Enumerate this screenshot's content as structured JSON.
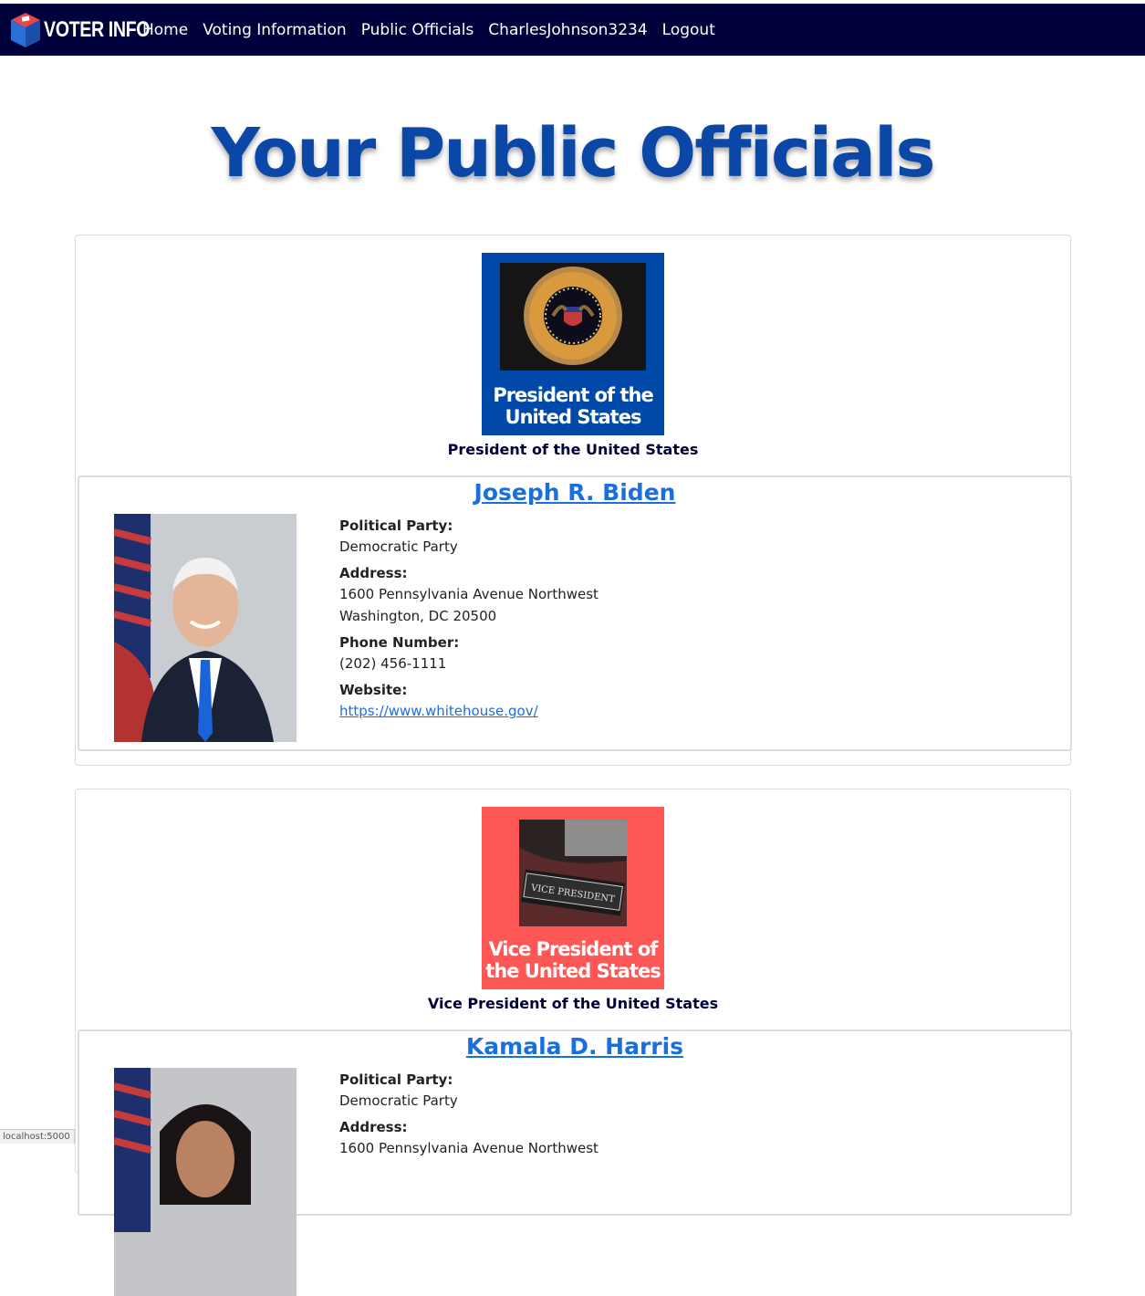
{
  "colors": {
    "navbar": "#00003a",
    "title": "#0a47a6",
    "link": "#1a6fdf",
    "office_name": "#00003a",
    "president_badge": "#0049a8",
    "vice_president_badge": "#fe5756"
  },
  "nav": {
    "brand": "VOTER INFO",
    "brand_icon": "ballot-box-icon",
    "links": [
      "Home",
      "Voting Information",
      "Public Officials",
      "CharlesJohnson3234",
      "Logout"
    ]
  },
  "page": {
    "title": "Your Public Officials"
  },
  "offices": [
    {
      "badge_caption": "President of the United States",
      "office_name": "President of the United States",
      "official": {
        "name": "Joseph R. Biden",
        "party_label": "Political Party:",
        "party": "Democratic Party",
        "address_label": "Address:",
        "address_line1": "1600 Pennsylvania Avenue Northwest",
        "address_line2": "Washington, DC 20500",
        "phone_label": "Phone Number:",
        "phone": "(202) 456-1111",
        "website_label": "Website:",
        "website": "https://www.whitehouse.gov/"
      }
    },
    {
      "badge_caption": "Vice President of the United States",
      "office_name": "Vice President of the United States",
      "official": {
        "name": "Kamala D. Harris",
        "party_label": "Political Party:",
        "party": "Democratic Party",
        "address_label": "Address:",
        "address_line1": "1600 Pennsylvania Avenue Northwest"
      }
    }
  ],
  "status_bar": "localhost:5000"
}
